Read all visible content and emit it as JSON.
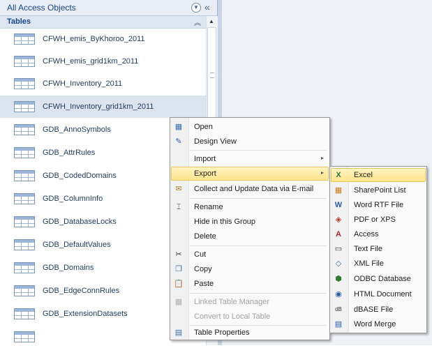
{
  "nav": {
    "title": "All Access Objects",
    "menu_button_icon": "chevron-down-circle",
    "collapse_icon": "double-chevron-left",
    "group_label": "Tables",
    "group_collapse_icon": "double-chevron-up",
    "items": [
      {
        "label": "CFWH_emis_ByKhoroo_2011"
      },
      {
        "label": "CFWH_emis_grid1km_2011"
      },
      {
        "label": "CFWH_Inventory_2011"
      },
      {
        "label": "CFWH_Inventory_grid1km_2011"
      },
      {
        "label": "GDB_AnnoSymbols"
      },
      {
        "label": "GDB_AttrRules"
      },
      {
        "label": "GDB_CodedDomains"
      },
      {
        "label": "GDB_ColumnInfo"
      },
      {
        "label": "GDB_DatabaseLocks"
      },
      {
        "label": "GDB_DefaultValues"
      },
      {
        "label": "GDB_Domains"
      },
      {
        "label": "GDB_EdgeConnRules"
      },
      {
        "label": "GDB_ExtensionDatasets"
      }
    ]
  },
  "context_menu": {
    "items": [
      {
        "label": "Open",
        "icon": "open-table-icon"
      },
      {
        "label": "Design View",
        "icon": "design-view-icon"
      },
      {
        "label": "Import"
      },
      {
        "label": "Export"
      },
      {
        "label": "Collect and Update Data via E-mail",
        "icon": "email-collect-icon"
      },
      {
        "label": "Rename",
        "icon": "rename-icon"
      },
      {
        "label": "Hide in this Group"
      },
      {
        "label": "Delete"
      },
      {
        "label": "Cut",
        "icon": "scissors-icon"
      },
      {
        "label": "Copy",
        "icon": "copy-icon"
      },
      {
        "label": "Paste",
        "icon": "paste-icon"
      },
      {
        "label": "Linked Table Manager",
        "icon": "linked-table-icon"
      },
      {
        "label": "Convert to Local Table"
      },
      {
        "label": "Table Properties",
        "icon": "properties-icon"
      }
    ]
  },
  "export_submenu": {
    "items": [
      {
        "label": "Excel",
        "icon": "excel-icon"
      },
      {
        "label": "SharePoint List",
        "icon": "sharepoint-icon"
      },
      {
        "label": "Word RTF File",
        "icon": "word-rtf-icon"
      },
      {
        "label": "PDF or XPS",
        "icon": "pdf-icon"
      },
      {
        "label": "Access",
        "icon": "access-icon"
      },
      {
        "label": "Text File",
        "icon": "text-file-icon"
      },
      {
        "label": "XML File",
        "icon": "xml-icon"
      },
      {
        "label": "ODBC Database",
        "icon": "odbc-icon"
      },
      {
        "label": "HTML Document",
        "icon": "html-icon"
      },
      {
        "label": "dBASE File",
        "icon": "dbase-icon"
      },
      {
        "label": "Word Merge",
        "icon": "word-merge-icon"
      }
    ]
  },
  "colors": {
    "highlight": "#fde58a",
    "nav_header": "#e9eef6",
    "group_header": "#dce6f2",
    "text": "#1e395b"
  }
}
